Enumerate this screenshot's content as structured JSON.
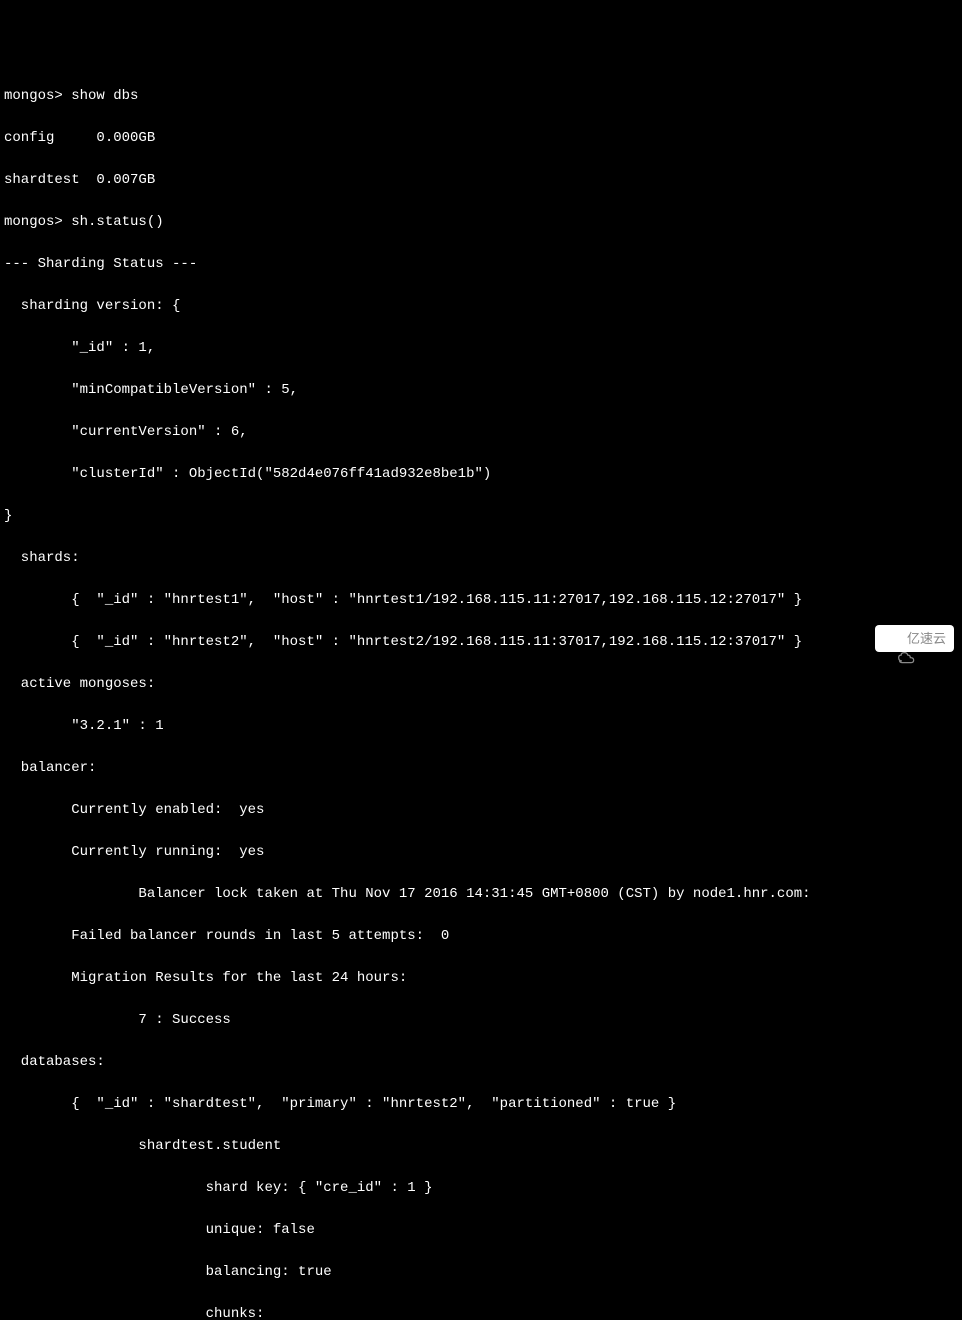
{
  "lines": {
    "l0": "mongos> show dbs",
    "l1": "config     0.000GB",
    "l2": "shardtest  0.007GB",
    "l3": "mongos> sh.status()",
    "l4": "--- Sharding Status ---",
    "l5": "  sharding version: {",
    "l6": "        \"_id\" : 1,",
    "l7": "        \"minCompatibleVersion\" : 5,",
    "l8": "        \"currentVersion\" : 6,",
    "l9": "        \"clusterId\" : ObjectId(\"582d4e076ff41ad932e8be1b\")",
    "l10": "}",
    "l11": "  shards:",
    "l12": "        {  \"_id\" : \"hnrtest1\",  \"host\" : \"hnrtest1/192.168.115.11:27017,192.168.115.12:27017\" }",
    "l13": "        {  \"_id\" : \"hnrtest2\",  \"host\" : \"hnrtest2/192.168.115.11:37017,192.168.115.12:37017\" }",
    "l14": "  active mongoses:",
    "l15": "        \"3.2.1\" : 1",
    "l16": "  balancer:",
    "l17": "        Currently enabled:  yes",
    "l18": "        Currently running:  yes",
    "l19": "                Balancer lock taken at Thu Nov 17 2016 14:31:45 GMT+0800 (CST) by node1.hnr.com:",
    "l20": "        Failed balancer rounds in last 5 attempts:  0",
    "l21": "        Migration Results for the last 24 hours:",
    "l22": "                7 : Success",
    "l23": "  databases:",
    "l24": "        {  \"_id\" : \"shardtest\",  \"primary\" : \"hnrtest2\",  \"partitioned\" : true }",
    "l25": "                shardtest.student",
    "l26": "                        shard key: { \"cre_id\" : 1 }",
    "l27": "                        unique: false",
    "l28": "                        balancing: true",
    "l29": "                        chunks:"
  },
  "watermark": {
    "text": "亿速云"
  }
}
